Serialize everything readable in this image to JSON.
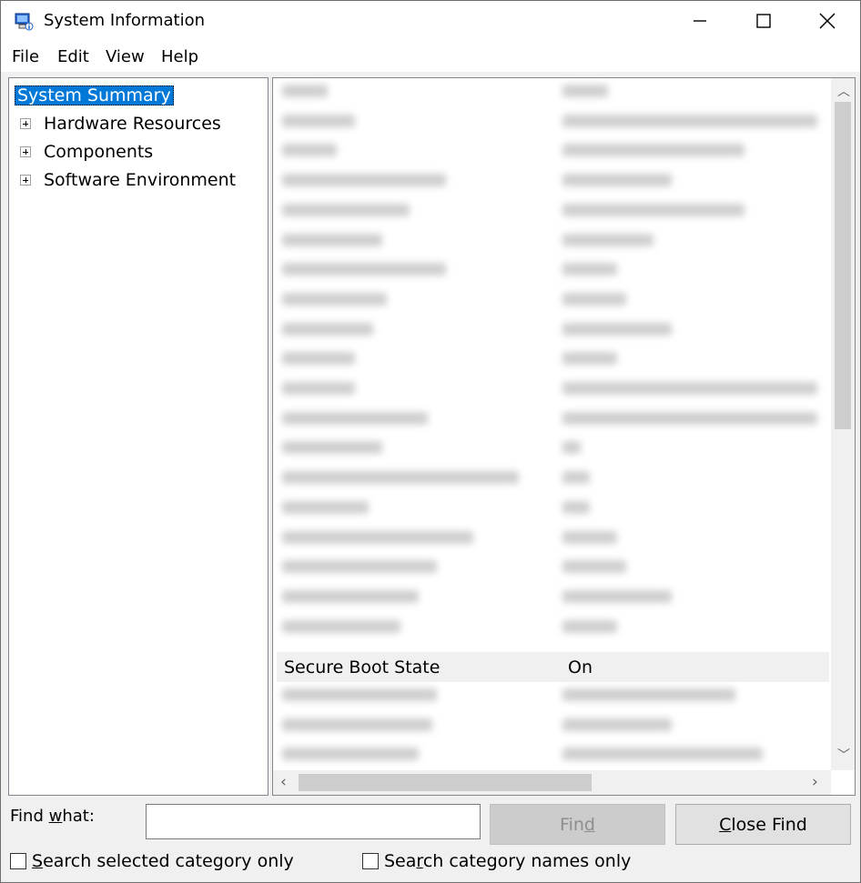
{
  "window": {
    "title": "System Information",
    "icon": "system-information-app-icon",
    "controls": [
      "minimize-icon",
      "maximize-icon",
      "close-icon"
    ]
  },
  "menu": {
    "file": "File",
    "edit": "Edit",
    "view": "View",
    "help": "Help"
  },
  "tree": {
    "root": "System Summary",
    "children": [
      "Hardware Resources",
      "Components",
      "Software Environment"
    ]
  },
  "details": {
    "visible_row": {
      "item": "Secure Boot State",
      "value": "On"
    }
  },
  "find_bar": {
    "label_prefix": "Find ",
    "label_accel": "w",
    "label_suffix": "hat:",
    "input_value": "",
    "find_prefix": "Fin",
    "find_accel": "d",
    "find_suffix": "",
    "close_accel": "C",
    "close_suffix": "lose Find",
    "option1_accel": "S",
    "option1_suffix": "earch selected category only",
    "option2_prefix": "Sea",
    "option2_accel": "r",
    "option2_suffix": "ch category names only"
  },
  "colors": {
    "selection": "#0078d7",
    "disabled_button": "#cccccc"
  }
}
